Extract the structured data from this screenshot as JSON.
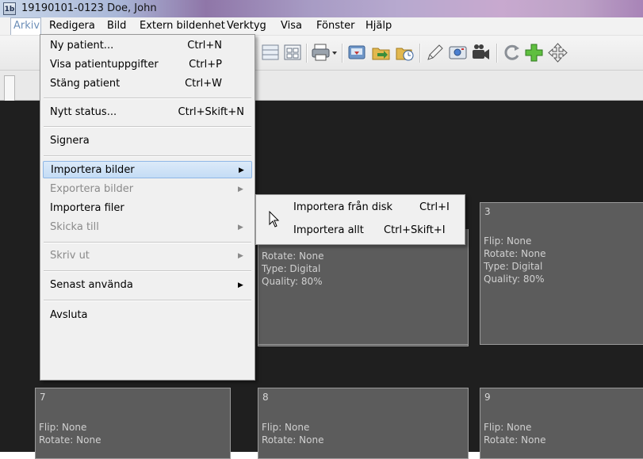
{
  "window": {
    "title": "19190101-0123 Doe, John",
    "icon_text": "1b"
  },
  "menubar": [
    {
      "label": "Arkiv"
    },
    {
      "label": "Redigera"
    },
    {
      "label": "Bild"
    },
    {
      "label": "Extern bildenhet"
    },
    {
      "label": "Verktyg"
    },
    {
      "label": "Visa"
    },
    {
      "label": "Fönster"
    },
    {
      "label": "Hjälp"
    }
  ],
  "arkiv_menu": {
    "items": [
      {
        "label": "Ny patient...",
        "shortcut": "Ctrl+N"
      },
      {
        "label": "Visa patientuppgifter",
        "shortcut": "Ctrl+P"
      },
      {
        "label": "Stäng patient",
        "shortcut": "Ctrl+W"
      },
      {
        "label": "Nytt status...",
        "shortcut": "Ctrl+Skift+N"
      },
      {
        "label": "Signera"
      },
      {
        "label": "Importera bilder",
        "submenu": true,
        "highlighted": true
      },
      {
        "label": "Exportera bilder",
        "submenu": true,
        "disabled": true
      },
      {
        "label": "Importera filer"
      },
      {
        "label": "Skicka till",
        "submenu": true,
        "disabled": true
      },
      {
        "label": "Skriv ut",
        "submenu": true,
        "disabled": true
      },
      {
        "label": "Senast använda",
        "submenu": true
      },
      {
        "label": "Avsluta"
      }
    ],
    "submenu_arrow": "▶"
  },
  "import_submenu": {
    "items": [
      {
        "label": "Importera från disk",
        "shortcut": "Ctrl+I"
      },
      {
        "label": "Importera allt",
        "shortcut": "Ctrl+Skift+I"
      }
    ]
  },
  "thumbnails": [
    {
      "number": "",
      "flip": "",
      "rotate": "Rotate: None",
      "type": "Type: Digital",
      "quality": "Quality: 80%"
    },
    {
      "number": "3",
      "flip": "Flip: None",
      "rotate": "Rotate: None",
      "type": "Type: Digital",
      "quality": "Quality: 80%"
    },
    {
      "number": "7",
      "flip": "Flip: None",
      "rotate": "Rotate: None"
    },
    {
      "number": "8",
      "flip": "Flip: None",
      "rotate": "Rotate: None"
    },
    {
      "number": "9",
      "flip": "Flip: None",
      "rotate": "Rotate: None"
    }
  ],
  "toolbar": {
    "icons": [
      "grid-view-icon",
      "thumbnail-view-icon",
      "print-icon",
      "print-dropdown-icon",
      "export-icon",
      "import-icon",
      "folder-clock-icon",
      "pen-icon",
      "camera-icon",
      "video-camera-icon",
      "rotate-icon",
      "add-icon",
      "move-icon"
    ]
  }
}
